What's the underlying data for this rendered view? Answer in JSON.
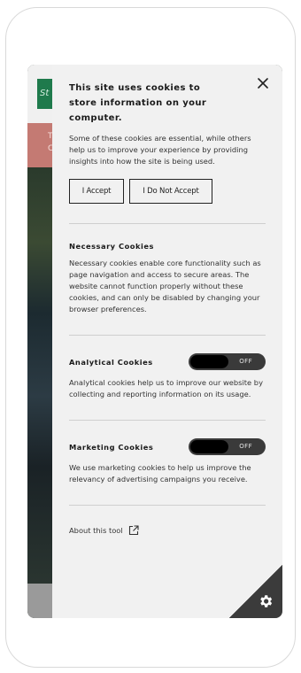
{
  "site": {
    "logo_glyph": "St",
    "banner_glyph": "T\nC"
  },
  "cookie_panel": {
    "title": "This site uses cookies to store information on your computer.",
    "intro": "Some of these cookies are essential, while others help us to improve your experience by providing insights into how the site is being used.",
    "accept_label": "I Accept",
    "decline_label": "I Do Not Accept",
    "sections": {
      "necessary": {
        "title": "Necessary Cookies",
        "description": "Necessary cookies enable core functionality such as page navigation and access to secure areas. The website cannot function properly without these cookies, and can only be disabled by changing your browser preferences."
      },
      "analytical": {
        "title": "Analytical Cookies",
        "toggle_state": "OFF",
        "description": "Analytical cookies help us to improve our website by collecting and reporting information on its usage."
      },
      "marketing": {
        "title": "Marketing Cookies",
        "toggle_state": "OFF",
        "description": "We use marketing cookies to help us improve the relevancy of advertising campaigns you receive."
      }
    },
    "about_label": "About this tool",
    "icons": {
      "close": "close-icon",
      "external": "external-link-icon",
      "settings": "gear-icon"
    }
  },
  "colors": {
    "panel_bg": "#f1f1f1",
    "toggle_bg": "#3a3a3a",
    "site_green": "#1f7a4c",
    "site_banner": "#c47a73"
  }
}
